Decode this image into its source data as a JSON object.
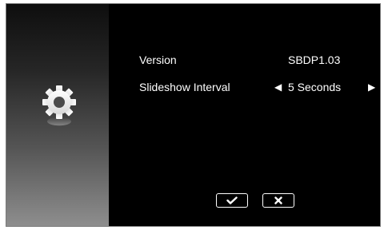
{
  "sidebar": {
    "icon": "gear-icon"
  },
  "settings": {
    "version": {
      "label": "Version",
      "value": "SBDP1.03"
    },
    "slideshow_interval": {
      "label": "Slideshow Interval",
      "value": "5 Seconds",
      "prev_glyph": "◀",
      "next_glyph": "▶"
    }
  },
  "buttons": {
    "confirm_icon": "checkmark-icon",
    "cancel_icon": "x-icon"
  },
  "colors": {
    "background": "#000000",
    "text": "#ffffff",
    "sidebar_top": "#0e0e0e",
    "sidebar_bottom": "#8e8e8e"
  }
}
